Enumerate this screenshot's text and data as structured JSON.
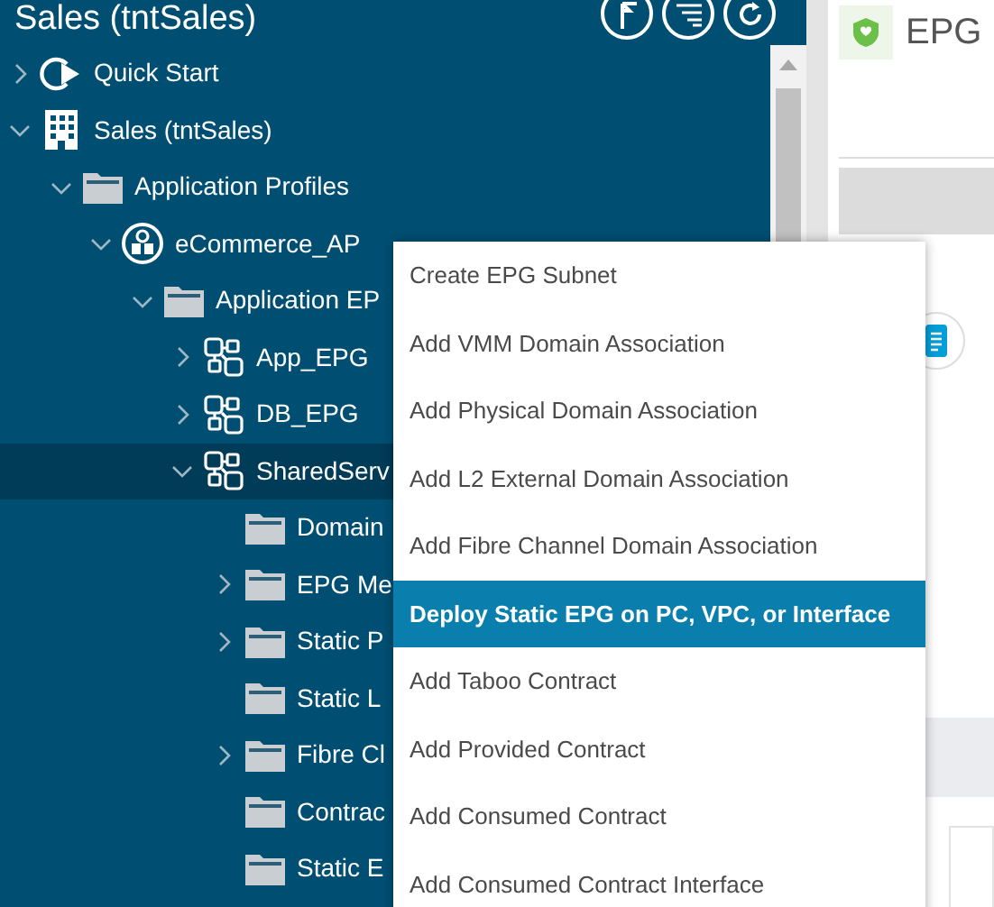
{
  "sidebar": {
    "title": "Sales (tntSales)",
    "tree": [
      {
        "label": "Quick Start",
        "kind": "quickstart",
        "expandable": true,
        "expanded": false,
        "selected": false
      },
      {
        "label": "Sales (tntSales)",
        "kind": "tenant",
        "expandable": true,
        "expanded": true,
        "selected": false,
        "children": [
          {
            "label": "Application Profiles",
            "kind": "folder",
            "expandable": true,
            "expanded": true,
            "selected": false,
            "children": [
              {
                "label": "eCommerce_AP",
                "kind": "app-profile",
                "expandable": true,
                "expanded": true,
                "selected": false,
                "children": [
                  {
                    "label": "Application EP",
                    "kind": "folder",
                    "expandable": true,
                    "expanded": true,
                    "selected": false,
                    "children": [
                      {
                        "label": "App_EPG",
                        "kind": "epg",
                        "expandable": true,
                        "expanded": false,
                        "selected": false
                      },
                      {
                        "label": "DB_EPG",
                        "kind": "epg",
                        "expandable": true,
                        "expanded": false,
                        "selected": false
                      },
                      {
                        "label": "SharedServ",
                        "kind": "epg",
                        "expandable": true,
                        "expanded": true,
                        "selected": true,
                        "children": [
                          {
                            "label": "Domain",
                            "kind": "folder",
                            "expandable": false,
                            "selected": false
                          },
                          {
                            "label": "EPG Me",
                            "kind": "folder",
                            "expandable": true,
                            "expanded": false,
                            "selected": false
                          },
                          {
                            "label": "Static P",
                            "kind": "folder",
                            "expandable": true,
                            "expanded": false,
                            "selected": false
                          },
                          {
                            "label": "Static L",
                            "kind": "folder",
                            "expandable": false,
                            "selected": false
                          },
                          {
                            "label": "Fibre Cl",
                            "kind": "folder",
                            "expandable": true,
                            "expanded": false,
                            "selected": false
                          },
                          {
                            "label": "Contrac",
                            "kind": "folder",
                            "expandable": false,
                            "selected": false
                          },
                          {
                            "label": "Static E",
                            "kind": "folder",
                            "expandable": false,
                            "selected": false
                          }
                        ]
                      }
                    ]
                  }
                ]
              }
            ]
          }
        ]
      }
    ]
  },
  "main": {
    "title": "EPG"
  },
  "context_menu": [
    {
      "label": "Create EPG Subnet",
      "selected": false
    },
    {
      "label": "Add VMM Domain Association",
      "selected": false
    },
    {
      "label": "Add Physical Domain Association",
      "selected": false
    },
    {
      "label": "Add L2 External Domain Association",
      "selected": false
    },
    {
      "label": "Add Fibre Channel Domain Association",
      "selected": false
    },
    {
      "label": "Deploy Static EPG on PC, VPC, or Interface",
      "selected": true
    },
    {
      "label": "Add Taboo Contract",
      "selected": false
    },
    {
      "label": "Add Provided Contract",
      "selected": false
    },
    {
      "label": "Add Consumed Contract",
      "selected": false
    },
    {
      "label": "Add Consumed Contract Interface",
      "selected": false
    }
  ]
}
